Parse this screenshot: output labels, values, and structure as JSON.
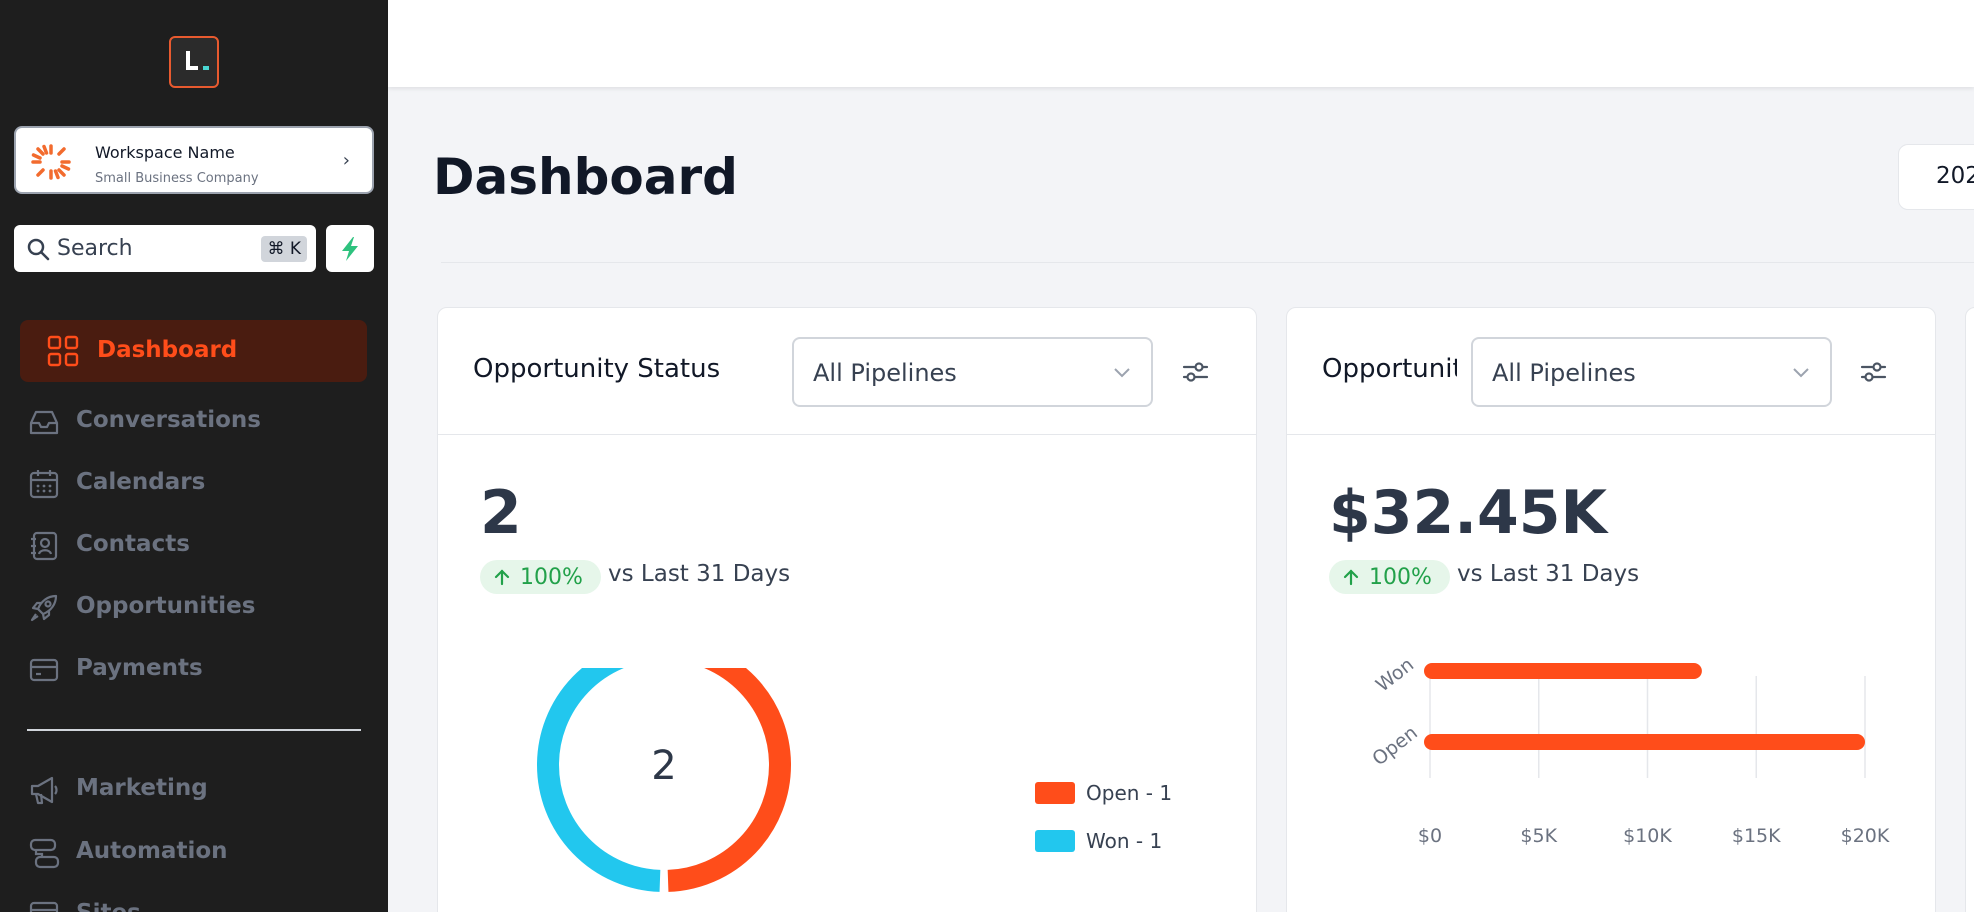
{
  "sidebar": {
    "workspace": {
      "name": "Workspace Name",
      "subtitle": "Small Business Company"
    },
    "search": {
      "label": "Search",
      "shortcut": "⌘ K"
    },
    "nav": [
      {
        "label": "Dashboard",
        "icon": "grid-icon",
        "active": true
      },
      {
        "label": "Conversations",
        "icon": "inbox-icon"
      },
      {
        "label": "Calendars",
        "icon": "calendar-icon"
      },
      {
        "label": "Contacts",
        "icon": "contact-icon"
      },
      {
        "label": "Opportunities",
        "icon": "rocket-icon"
      },
      {
        "label": "Payments",
        "icon": "credit-card-icon"
      },
      {
        "label": "Marketing",
        "icon": "megaphone-icon"
      },
      {
        "label": "Automation",
        "icon": "workflow-icon"
      },
      {
        "label": "Sites",
        "icon": "sites-icon"
      }
    ],
    "accent": "#ff4d1a"
  },
  "header": {
    "title": "Dashboard",
    "date_value": "202"
  },
  "cards": [
    {
      "title": "Opportunity Status",
      "pipeline": "All Pipelines",
      "value": "2",
      "change": "100%",
      "comparison": "vs Last 31 Days",
      "chart_data": {
        "type": "pie",
        "center_label": "2",
        "slices": [
          {
            "label": "Open - 1",
            "value": 1,
            "color": "#ff4d1a"
          },
          {
            "label": "Won - 1",
            "value": 1,
            "color": "#22c7ee"
          }
        ]
      }
    },
    {
      "title": "Opportunity Value",
      "pipeline": "All Pipelines",
      "value": "$32.45K",
      "change": "100%",
      "comparison": "vs Last 31 Days",
      "chart_data": {
        "type": "bar",
        "orientation": "horizontal",
        "categories": [
          "Won",
          "Open"
        ],
        "values": [
          12500,
          20000
        ],
        "xlim": [
          0,
          20000
        ],
        "ticks": [
          "$0",
          "$5K",
          "$10K",
          "$15K",
          "$20K"
        ],
        "grid": true,
        "color": "#ff4d1a"
      }
    }
  ]
}
